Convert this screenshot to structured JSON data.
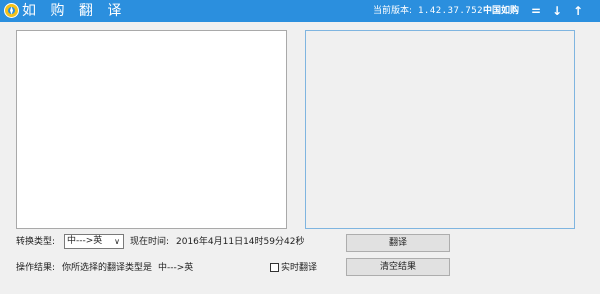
{
  "window": {
    "title": "如 购 翻 译",
    "version_label": "当前版本:",
    "version_value": "1.42.37.752",
    "brand_link": "中国如购",
    "menu_icon": "menu-icon",
    "minimize_icon": "minimize-icon",
    "close_icon": "close-icon"
  },
  "controls": {
    "convert_type_label": "转换类型:",
    "convert_type_value": "中--->英",
    "current_time_label": "现在时间:",
    "current_time_value": "2016年4月11日14时59分42秒",
    "translate_button": "翻译",
    "clear_button": "清空结果",
    "realtime_label": "实时翻译",
    "realtime_checked": false,
    "result_label": "操作结果:",
    "result_text": "你所选择的翻译类型是",
    "result_value": "中--->英"
  },
  "colors": {
    "titlebar": "#2b8fde",
    "background": "#f0f0f0"
  }
}
